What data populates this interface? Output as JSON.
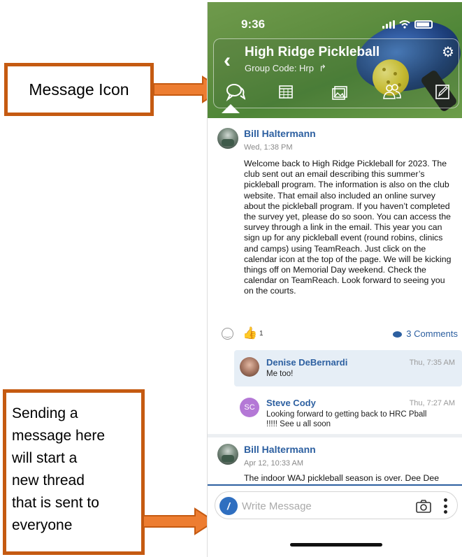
{
  "callouts": {
    "message_icon": "Message Icon",
    "sending_lines": [
      "Sending a",
      "message here",
      "will start a",
      "new thread",
      "that is sent to",
      "everyone"
    ]
  },
  "status_bar": {
    "time": "9:36"
  },
  "group": {
    "title": "High Ridge Pickleball",
    "code_text": "Group Code: Hrp",
    "tabs": [
      "message-icon",
      "calendar-icon",
      "photos-icon",
      "members-icon",
      "edit-icon"
    ]
  },
  "posts": [
    {
      "author": "Bill Haltermann",
      "time": "Wed, 1:38 PM",
      "body": "Welcome back to High Ridge Pickleball for 2023. The club sent out an email describing this summer’s pickleball program. The information is also on the club website. That email also included an online survey about the pickleball program. If you haven’t completed the survey yet, please do so soon. You can access the survey through a link in the email. This year you can sign up for any pickleball event (round robins, clinics and camps) using TeamReach. Just click on the calendar icon at the top of the page. We will be kicking things off on Memorial Day weekend. Check the calendar on TeamReach. Look forward to seeing you on the courts.",
      "likes": "1",
      "comments_label": "3 Comments",
      "comments": [
        {
          "author": "Denise DeBernardi",
          "time": "Thu, 7:35 AM",
          "text": "Me too!"
        },
        {
          "author": "Steve Cody",
          "initials": "SC",
          "time": "Thu, 7:27 AM",
          "text": "Looking forward to getting back to HRC Pball !!!!! See u all soon"
        }
      ]
    },
    {
      "author": "Bill Haltermann",
      "time": "Apr 12, 10:33 AM",
      "body": "The indoor WAJ pickleball season is over. Dee Dee and I will be organizing outdoor play once we return from the Cape in May. Remember the nets"
    }
  ],
  "composer": {
    "placeholder": "Write Message"
  },
  "colors": {
    "accent": "#c55a11",
    "link": "#2c5fa0",
    "header_green": "#5f8e40"
  }
}
